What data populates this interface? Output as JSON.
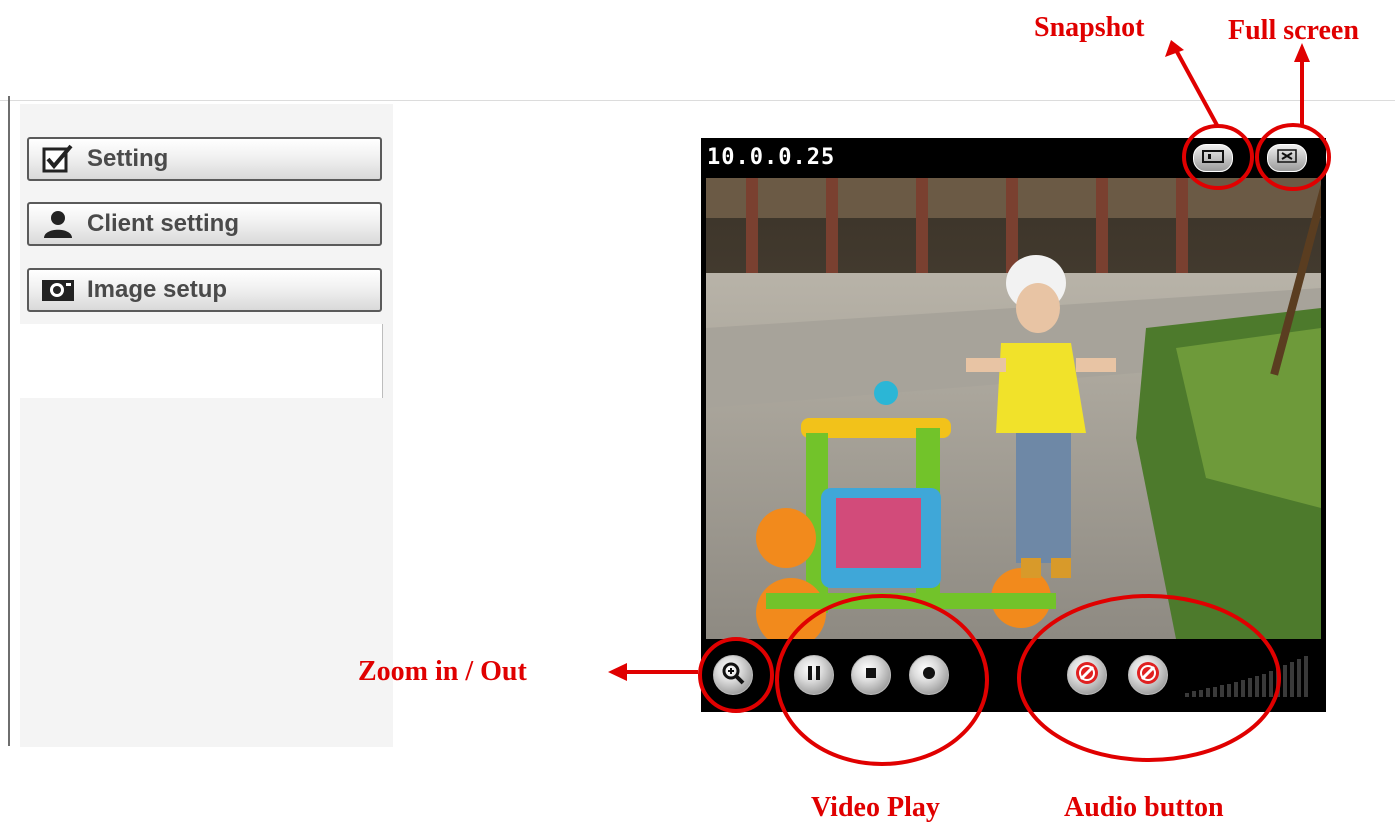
{
  "sidebar": {
    "items": [
      {
        "label": "Setting",
        "icon": "checkbox-icon"
      },
      {
        "label": "Client setting",
        "icon": "user-icon"
      },
      {
        "label": "Image setup",
        "icon": "camera-icon"
      }
    ]
  },
  "player": {
    "ip_address": "10.0.0.25",
    "top_buttons": [
      {
        "icon": "snapshot-icon"
      },
      {
        "icon": "fullscreen-icon"
      }
    ],
    "controls": [
      {
        "icon": "zoom-icon"
      },
      {
        "icon": "pause-icon"
      },
      {
        "icon": "stop-icon"
      },
      {
        "icon": "record-icon"
      },
      {
        "icon": "speaker-mute-icon"
      },
      {
        "icon": "microphone-mute-icon"
      }
    ]
  },
  "annotations": {
    "snapshot": "Snapshot",
    "full_screen": "Full screen",
    "zoom": "Zoom in / Out",
    "video_play": "Video Play",
    "audio_button": "Audio button"
  },
  "colors": {
    "annotation": "#e00000",
    "player_bg": "#000000",
    "sidebar_bg": "#f4f4f4"
  }
}
